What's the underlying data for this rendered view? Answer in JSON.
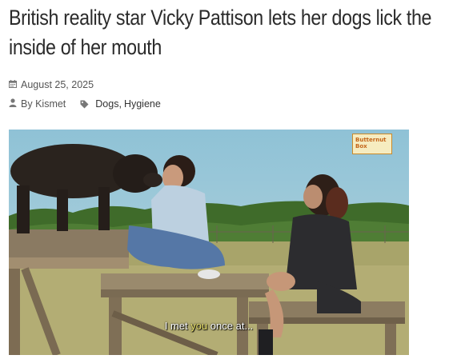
{
  "article": {
    "title": "British reality star Vicky Pattison lets her dogs lick the inside of her mouth",
    "date": "August 25, 2025",
    "author_prefix": "By",
    "author": "Kismet",
    "tags": [
      "Dogs",
      "Hygiene"
    ],
    "tag_separator": ","
  },
  "media": {
    "subtitle_part1": "I met ",
    "subtitle_highlight": "you",
    "subtitle_part2": " once at...",
    "logo_line1": "Butternut",
    "logo_line2": "Box"
  },
  "icons": {
    "date": "calendar-icon",
    "author": "user-icon",
    "tags": "tag-icon"
  },
  "colors": {
    "title": "#2b2b2b",
    "meta": "#555555",
    "subtitle_highlight": "#e8e069",
    "logo_border": "#c98a2a"
  }
}
